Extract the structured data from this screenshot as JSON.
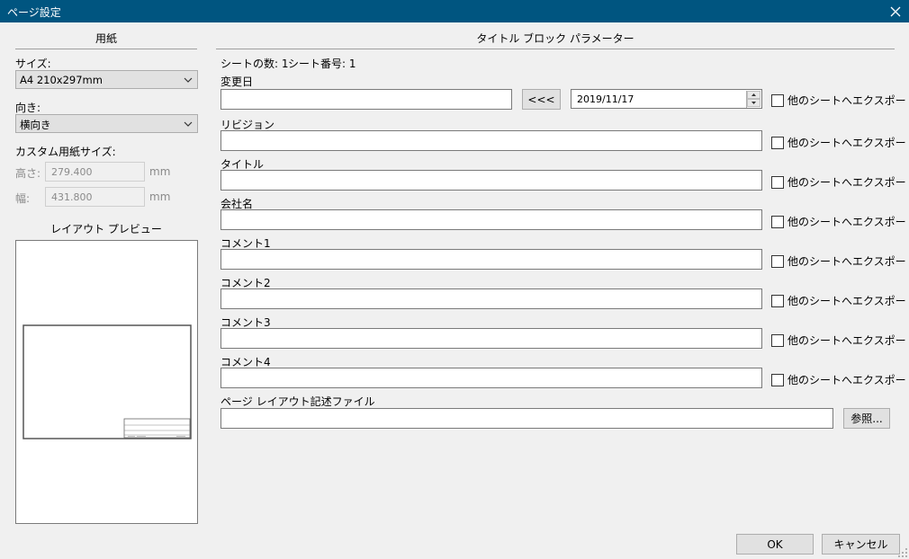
{
  "window": {
    "title": "ページ設定"
  },
  "paper": {
    "header": "用紙",
    "size_label": "サイズ:",
    "size_value": "A4 210x297mm",
    "orientation_label": "向き:",
    "orientation_value": "横向き",
    "custom_label": "カスタム用紙サイズ:",
    "height_label": "高さ:",
    "height_value": "279.400",
    "width_label": "幅:",
    "width_value": "431.800",
    "unit": "mm",
    "preview_header": "レイアウト プレビュー"
  },
  "titleblock": {
    "header": "タイトル ブロック パラメーター",
    "sheet_count": "シートの数: 1",
    "sheet_number": "シート番号: 1",
    "date_label": "変更日",
    "date_button": "<<<",
    "date_value": "2019/11/17",
    "export_label": "他のシートへエクスポート",
    "fields": [
      {
        "label": "リビジョン",
        "value": ""
      },
      {
        "label": "タイトル",
        "value": ""
      },
      {
        "label": "会社名",
        "value": ""
      },
      {
        "label": "コメント1",
        "value": ""
      },
      {
        "label": "コメント2",
        "value": ""
      },
      {
        "label": "コメント3",
        "value": ""
      },
      {
        "label": "コメント4",
        "value": ""
      }
    ],
    "layout_file_label": "ページ レイアウト記述ファイル",
    "layout_file_value": "",
    "browse_button": "参照..."
  },
  "buttons": {
    "ok": "OK",
    "cancel": "キャンセル"
  }
}
